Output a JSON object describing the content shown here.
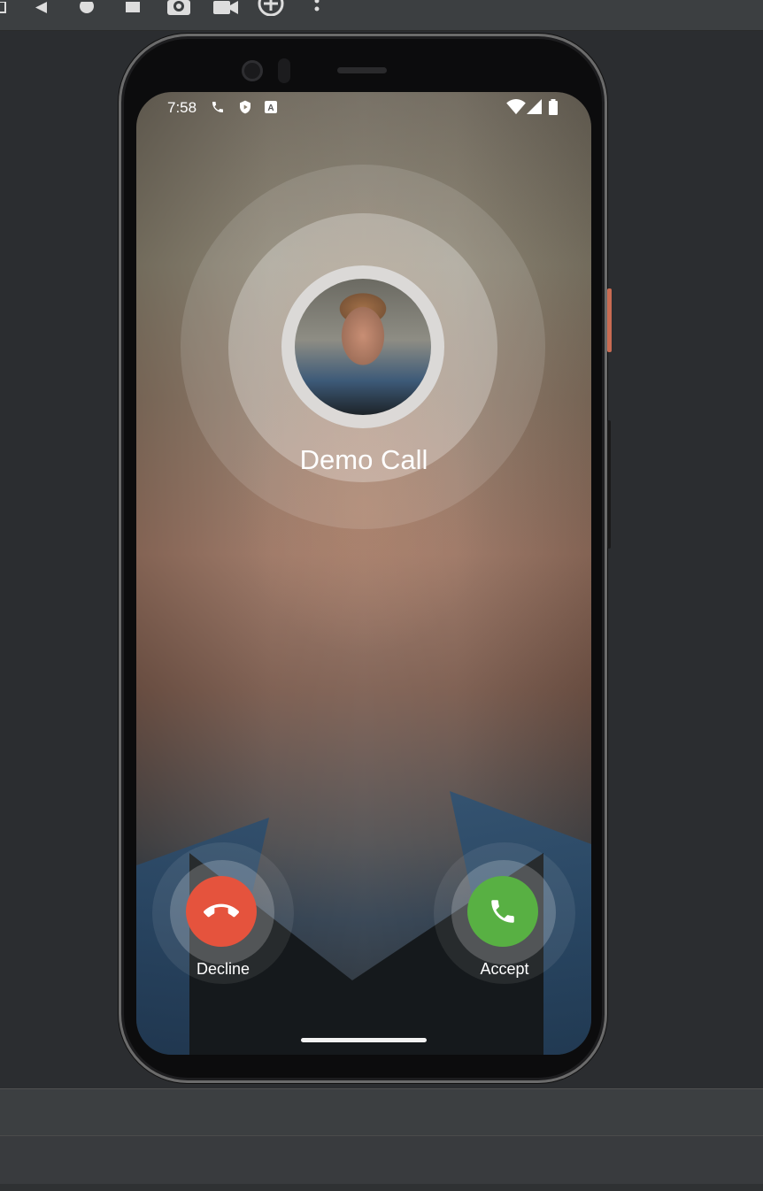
{
  "emulator": {
    "toolbar_icons": [
      "back-icon",
      "home-icon",
      "overview-icon",
      "camera-icon",
      "video-icon",
      "zoom-icon",
      "more-icon"
    ]
  },
  "status_bar": {
    "time": "7:58",
    "icons": [
      "phone-icon",
      "shield-icon",
      "a-badge-icon",
      "wifi-icon",
      "signal-icon",
      "battery-icon"
    ]
  },
  "call": {
    "caller_name": "Demo Call",
    "decline_label": "Decline",
    "accept_label": "Accept"
  },
  "colors": {
    "decline": "#e5533d",
    "accept": "#58b043"
  }
}
